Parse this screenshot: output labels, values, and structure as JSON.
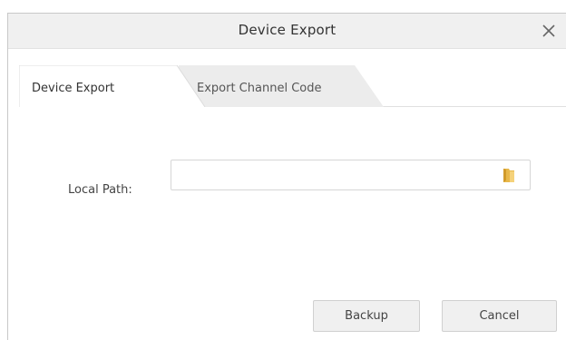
{
  "dialog": {
    "title": "Device Export",
    "close_icon": "close-icon"
  },
  "tabs": [
    {
      "label": "Device Export",
      "active": true
    },
    {
      "label": "Export Channel Code",
      "active": false
    }
  ],
  "form": {
    "local_path_label": "Local Path:",
    "local_path_value": "",
    "local_path_placeholder": "",
    "browse_icon": "folder-icon"
  },
  "buttons": {
    "backup": "Backup",
    "cancel": "Cancel"
  },
  "colors": {
    "titlebar_bg": "#f0f0f0",
    "tab_inactive_bg": "#ececec",
    "button_bg": "#f0f0f0",
    "folder_icon": "#e8b84a"
  }
}
